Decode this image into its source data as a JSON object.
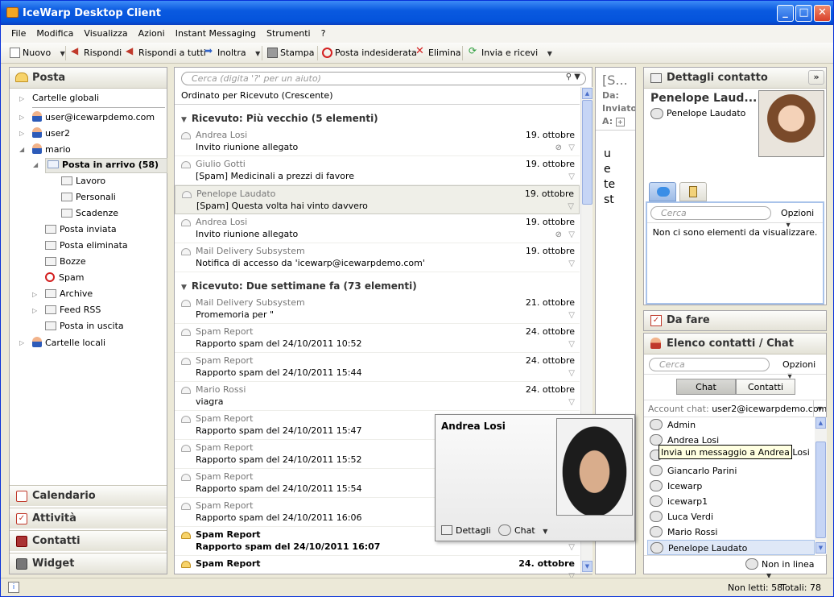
{
  "window": {
    "title": "IceWarp Desktop Client"
  },
  "menu": [
    "File",
    "Modifica",
    "Visualizza",
    "Azioni",
    "Instant Messaging",
    "Strumenti",
    "?"
  ],
  "toolbar": {
    "new": "Nuovo",
    "reply": "Rispondi",
    "reply_all": "Rispondi a tutti",
    "forward": "Inoltra",
    "print": "Stampa",
    "junk": "Posta indesiderata",
    "delete": "Elimina",
    "send_receive": "Invia e ricevi"
  },
  "sidebar": {
    "header": "Posta",
    "global_folders": "Cartelle globali",
    "accounts": [
      "user@icewarpdemo.com",
      "user2",
      "mario"
    ],
    "inbox": "Posta in arrivo (58)",
    "subfolders": [
      "Lavoro",
      "Personali",
      "Scadenze"
    ],
    "folders": [
      "Posta inviata",
      "Posta eliminata",
      "Bozze",
      "Spam",
      "Archive",
      "Feed RSS",
      "Posta in uscita"
    ],
    "local_folders": "Cartelle locali",
    "nav": [
      "Calendario",
      "Attività",
      "Contatti",
      "Widget"
    ]
  },
  "maillist": {
    "search_placeholder": "Cerca (digita '?' per un aiuto)",
    "sort_label": "Ordinato per Ricevuto (Crescente)",
    "group1": "Ricevuto: Più vecchio  (5 elementi)",
    "group2": "Ricevuto: Due settimane fa  (73 elementi)",
    "messages1": [
      {
        "from": "Andrea Losi",
        "subject": "Invito riunione allegato",
        "date": "19. ottobre"
      },
      {
        "from": "Giulio Gotti",
        "subject": "[Spam] Medicinali a prezzi di favore",
        "date": "19. ottobre"
      },
      {
        "from": "Penelope Laudato",
        "subject": "[Spam] Questa volta hai vinto davvero",
        "date": "19. ottobre"
      },
      {
        "from": "Andrea Losi",
        "subject": "Invito riunione allegato",
        "date": "19. ottobre"
      },
      {
        "from": "Mail Delivery Subsystem",
        "subject": "Notifica di accesso da 'icewarp@icewarpdemo.com'",
        "date": "19. ottobre"
      }
    ],
    "messages2": [
      {
        "from": "Mail Delivery Subsystem",
        "subject": "Promemoria per \"",
        "date": "21. ottobre"
      },
      {
        "from": "Spam Report",
        "subject": "Rapporto spam del 24/10/2011 10:52",
        "date": "24. ottobre"
      },
      {
        "from": "Spam Report",
        "subject": "Rapporto spam del 24/10/2011 15:44",
        "date": "24. ottobre"
      },
      {
        "from": "Mario Rossi",
        "subject": "viagra",
        "date": "24. ottobre"
      },
      {
        "from": "Spam Report",
        "subject": "Rapporto spam del 24/10/2011 15:47",
        "date": ""
      },
      {
        "from": "Spam Report",
        "subject": "Rapporto spam del 24/10/2011 15:52",
        "date": ""
      },
      {
        "from": "Spam Report",
        "subject": "Rapporto spam del 24/10/2011 15:54",
        "date": ""
      },
      {
        "from": "Spam Report",
        "subject": "Rapporto spam del 24/10/2011 16:06",
        "date": ""
      },
      {
        "from": "Spam Report",
        "subject": "Rapporto spam del 24/10/2011 16:07",
        "date": ""
      },
      {
        "from": "Spam Report",
        "subject": "",
        "date": "24. ottobre"
      }
    ]
  },
  "preview": {
    "subject": "[S...",
    "from_label": "Da:",
    "sent_label": "Inviato",
    "to_label": "A:",
    "body": [
      "u",
      "e",
      "te",
      "st"
    ]
  },
  "contact_details": {
    "header": "Dettagli contatto",
    "name": "Penelope Laud...",
    "chat_name": "Penelope Laudato",
    "search_placeholder": "Cerca",
    "options": "Opzioni",
    "empty": "Non ci sono elementi da visualizzare."
  },
  "todo": {
    "header": "Da fare"
  },
  "contacts": {
    "header": "Elenco contatti / Chat",
    "search_placeholder": "Cerca",
    "options": "Opzioni",
    "tab_chat": "Chat",
    "tab_contacts": "Contatti",
    "account_label": "Account chat:",
    "account_value": "user2@icewarpdemo.com/",
    "list": [
      "Admin",
      "Andrea Losi",
      "",
      "Giancarlo Parini",
      "Icewarp",
      "icewarp1",
      "Luca Verdi",
      "Mario Rossi",
      "Penelope Laudato"
    ],
    "status": "Non in linea"
  },
  "popup": {
    "name": "Andrea Losi",
    "details": "Dettagli",
    "chat": "Chat"
  },
  "tooltip": "Invia un messaggio a Andrea Losi",
  "status": {
    "unread": "Non letti: 58",
    "total": "Totali: 78"
  }
}
